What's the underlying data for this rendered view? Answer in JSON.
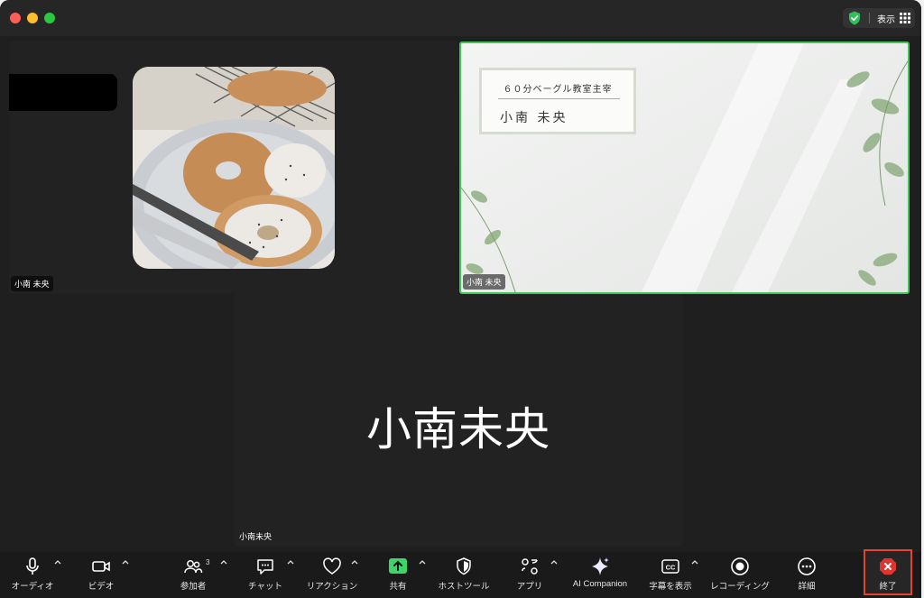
{
  "header": {
    "view_label": "表示"
  },
  "tiles": [
    {
      "participant_name": "小南 未央"
    },
    {
      "participant_name": "小南 未央",
      "slide": {
        "subtitle": "６０分ベーグル教室主宰",
        "name": "小南 未央"
      }
    },
    {
      "participant_name": "小南未央",
      "display_name": "小南未央"
    }
  ],
  "toolbar": {
    "audio": "オーディオ",
    "video": "ビデオ",
    "participants": "参加者",
    "participants_count": "3",
    "chat": "チャット",
    "reactions": "リアクション",
    "share": "共有",
    "host_tools": "ホストツール",
    "apps": "アプリ",
    "ai_companion": "AI Companion",
    "captions": "字幕を表示",
    "recording": "レコーディング",
    "more": "詳細",
    "end": "終了"
  },
  "colors": {
    "active_speaker_border": "#46c25a",
    "end_highlight": "#e5452f",
    "share_green": "#3fd36b",
    "end_red": "#e0342f"
  },
  "icons": [
    "shield-icon",
    "grid-icon",
    "microphone-icon",
    "video-camera-icon",
    "participants-icon",
    "chat-icon",
    "heart-icon",
    "share-arrow-icon",
    "host-shield-icon",
    "apps-icon",
    "sparkle-icon",
    "cc-icon",
    "record-icon",
    "ellipsis-icon",
    "end-x-icon",
    "chevron-up-icon"
  ]
}
